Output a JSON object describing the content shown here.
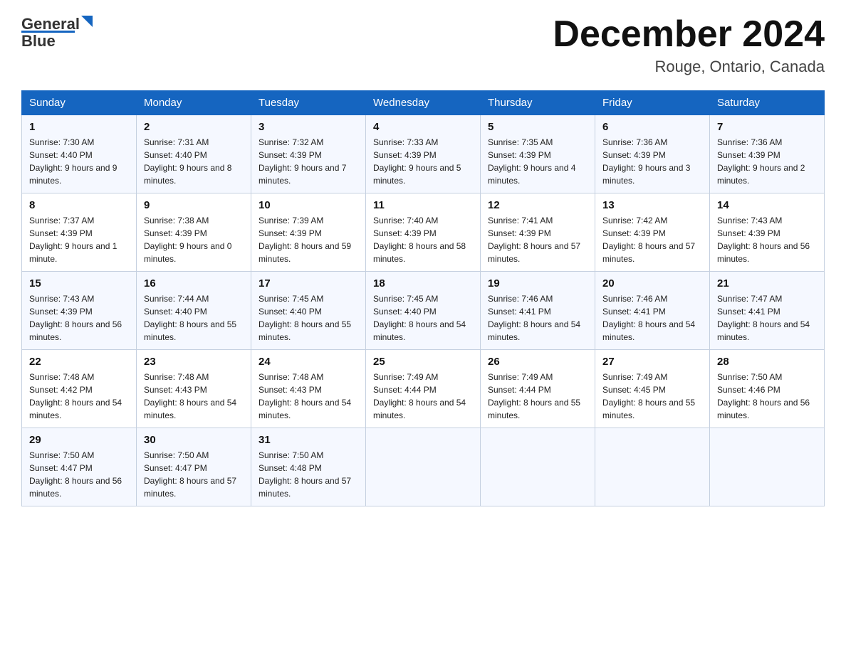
{
  "header": {
    "logo_text_general": "General",
    "logo_text_blue": "Blue",
    "month_title": "December 2024",
    "location": "Rouge, Ontario, Canada"
  },
  "days_of_week": [
    "Sunday",
    "Monday",
    "Tuesday",
    "Wednesday",
    "Thursday",
    "Friday",
    "Saturday"
  ],
  "weeks": [
    [
      {
        "day": "1",
        "sunrise": "7:30 AM",
        "sunset": "4:40 PM",
        "daylight": "9 hours and 9 minutes."
      },
      {
        "day": "2",
        "sunrise": "7:31 AM",
        "sunset": "4:40 PM",
        "daylight": "9 hours and 8 minutes."
      },
      {
        "day": "3",
        "sunrise": "7:32 AM",
        "sunset": "4:39 PM",
        "daylight": "9 hours and 7 minutes."
      },
      {
        "day": "4",
        "sunrise": "7:33 AM",
        "sunset": "4:39 PM",
        "daylight": "9 hours and 5 minutes."
      },
      {
        "day": "5",
        "sunrise": "7:35 AM",
        "sunset": "4:39 PM",
        "daylight": "9 hours and 4 minutes."
      },
      {
        "day": "6",
        "sunrise": "7:36 AM",
        "sunset": "4:39 PM",
        "daylight": "9 hours and 3 minutes."
      },
      {
        "day": "7",
        "sunrise": "7:36 AM",
        "sunset": "4:39 PM",
        "daylight": "9 hours and 2 minutes."
      }
    ],
    [
      {
        "day": "8",
        "sunrise": "7:37 AM",
        "sunset": "4:39 PM",
        "daylight": "9 hours and 1 minute."
      },
      {
        "day": "9",
        "sunrise": "7:38 AM",
        "sunset": "4:39 PM",
        "daylight": "9 hours and 0 minutes."
      },
      {
        "day": "10",
        "sunrise": "7:39 AM",
        "sunset": "4:39 PM",
        "daylight": "8 hours and 59 minutes."
      },
      {
        "day": "11",
        "sunrise": "7:40 AM",
        "sunset": "4:39 PM",
        "daylight": "8 hours and 58 minutes."
      },
      {
        "day": "12",
        "sunrise": "7:41 AM",
        "sunset": "4:39 PM",
        "daylight": "8 hours and 57 minutes."
      },
      {
        "day": "13",
        "sunrise": "7:42 AM",
        "sunset": "4:39 PM",
        "daylight": "8 hours and 57 minutes."
      },
      {
        "day": "14",
        "sunrise": "7:43 AM",
        "sunset": "4:39 PM",
        "daylight": "8 hours and 56 minutes."
      }
    ],
    [
      {
        "day": "15",
        "sunrise": "7:43 AM",
        "sunset": "4:39 PM",
        "daylight": "8 hours and 56 minutes."
      },
      {
        "day": "16",
        "sunrise": "7:44 AM",
        "sunset": "4:40 PM",
        "daylight": "8 hours and 55 minutes."
      },
      {
        "day": "17",
        "sunrise": "7:45 AM",
        "sunset": "4:40 PM",
        "daylight": "8 hours and 55 minutes."
      },
      {
        "day": "18",
        "sunrise": "7:45 AM",
        "sunset": "4:40 PM",
        "daylight": "8 hours and 54 minutes."
      },
      {
        "day": "19",
        "sunrise": "7:46 AM",
        "sunset": "4:41 PM",
        "daylight": "8 hours and 54 minutes."
      },
      {
        "day": "20",
        "sunrise": "7:46 AM",
        "sunset": "4:41 PM",
        "daylight": "8 hours and 54 minutes."
      },
      {
        "day": "21",
        "sunrise": "7:47 AM",
        "sunset": "4:41 PM",
        "daylight": "8 hours and 54 minutes."
      }
    ],
    [
      {
        "day": "22",
        "sunrise": "7:48 AM",
        "sunset": "4:42 PM",
        "daylight": "8 hours and 54 minutes."
      },
      {
        "day": "23",
        "sunrise": "7:48 AM",
        "sunset": "4:43 PM",
        "daylight": "8 hours and 54 minutes."
      },
      {
        "day": "24",
        "sunrise": "7:48 AM",
        "sunset": "4:43 PM",
        "daylight": "8 hours and 54 minutes."
      },
      {
        "day": "25",
        "sunrise": "7:49 AM",
        "sunset": "4:44 PM",
        "daylight": "8 hours and 54 minutes."
      },
      {
        "day": "26",
        "sunrise": "7:49 AM",
        "sunset": "4:44 PM",
        "daylight": "8 hours and 55 minutes."
      },
      {
        "day": "27",
        "sunrise": "7:49 AM",
        "sunset": "4:45 PM",
        "daylight": "8 hours and 55 minutes."
      },
      {
        "day": "28",
        "sunrise": "7:50 AM",
        "sunset": "4:46 PM",
        "daylight": "8 hours and 56 minutes."
      }
    ],
    [
      {
        "day": "29",
        "sunrise": "7:50 AM",
        "sunset": "4:47 PM",
        "daylight": "8 hours and 56 minutes."
      },
      {
        "day": "30",
        "sunrise": "7:50 AM",
        "sunset": "4:47 PM",
        "daylight": "8 hours and 57 minutes."
      },
      {
        "day": "31",
        "sunrise": "7:50 AM",
        "sunset": "4:48 PM",
        "daylight": "8 hours and 57 minutes."
      },
      null,
      null,
      null,
      null
    ]
  ]
}
